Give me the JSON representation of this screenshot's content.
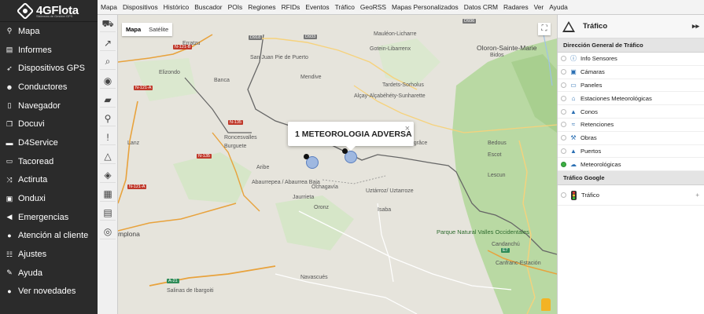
{
  "brand": {
    "name": "4GFlota",
    "tagline": "Sistemas de Gestión GPS"
  },
  "sidebar": {
    "items": [
      {
        "label": "Mapa",
        "icon": "map-pin-icon"
      },
      {
        "label": "Informes",
        "icon": "report-icon"
      },
      {
        "label": "Dispositivos GPS",
        "icon": "rocket-icon"
      },
      {
        "label": "Conductores",
        "icon": "user-icon"
      },
      {
        "label": "Navegador",
        "icon": "phone-icon"
      },
      {
        "label": "Docuvi",
        "icon": "documents-icon"
      },
      {
        "label": "D4Service",
        "icon": "folder-icon"
      },
      {
        "label": "Tacoread",
        "icon": "hdd-icon"
      },
      {
        "label": "Actiruta",
        "icon": "route-icon"
      },
      {
        "label": "Onduxi",
        "icon": "bus-icon"
      },
      {
        "label": "Emergencias",
        "icon": "bullhorn-icon"
      },
      {
        "label": "Atención al cliente",
        "icon": "info-icon"
      },
      {
        "label": "Ajustes",
        "icon": "settings-icon"
      },
      {
        "label": "Ayuda",
        "icon": "help-icon"
      },
      {
        "label": "Ver novedades",
        "icon": "dot-icon"
      }
    ]
  },
  "topmenu": [
    "Mapa",
    "Dispositivos",
    "Histórico",
    "Buscador",
    "POIs",
    "Regiones",
    "RFIDs",
    "Eventos",
    "Tráfico",
    "GeoRSS",
    "Mapas Personalizados",
    "Datos CRM",
    "Radares",
    "Ver",
    "Ayuda"
  ],
  "tools": [
    "truck-icon",
    "route-icon",
    "search-icon",
    "pin-icon",
    "hat-icon",
    "marker-icon",
    "alert-marker-icon",
    "traffic-icon",
    "layer-icon",
    "grid-icon",
    "case-icon",
    "target-icon"
  ],
  "map": {
    "type_buttons": [
      "Mapa",
      "Satélite"
    ],
    "popup_text": "1 METEOROLOGIA ADVERSA",
    "labels": {
      "mauleon": "Mauléon-Licharre",
      "gotein": "Gotein-Libarrenx",
      "oloron": "Oloron-Sainte-Marie",
      "bidos": "Bidos",
      "sjp": "San Juan Pie de Puerto",
      "erratzu": "Erratzu",
      "elizondo": "Elizondo",
      "banca": "Banca",
      "mendive": "Mendive",
      "tardets": "Tardets-Sorholus",
      "alcay": "Alçay-Alçabéhéty-Sunharette",
      "roncesvalles": "Roncesvalles",
      "burguete": "Burguete",
      "lanz": "Lanz",
      "sainte": "Sainte-Engrâce",
      "bedous": "Bedous",
      "escot": "Escot",
      "aribe": "Aribe",
      "lescun": "Lescun",
      "abaurrepea": "Abaurrepea / Abaurrea Baja",
      "ochagavia": "Ochagavía",
      "jaurrieta": "Jaurrieta",
      "uztarroz": "Uztárroz/ Uztarroze",
      "isaba": "Isaba",
      "oronz": "Oronz",
      "pamplona": "mplona",
      "parque": "Parque Natural Valles Occidentales",
      "navascues": "Navascués",
      "canfranc": "Canfranc-Estación",
      "candanchu": "Candanchú",
      "salinas": "Salinas de Ibargoiti"
    },
    "roads": {
      "d918": "D918",
      "d933": "D933",
      "d936": "D936",
      "n121b": "N-121-B",
      "n121a": "N-121-A",
      "n135a": "N-135",
      "n135b": "N-135",
      "n121a2": "N-121-A",
      "a21": "A-21",
      "e7": "E7"
    }
  },
  "panel": {
    "title": "Tráfico",
    "collapse": "▸▸",
    "section_dgt": "Dirección General de Tráfico",
    "layers": [
      {
        "label": "Info Sensores",
        "on": false
      },
      {
        "label": "Cámaras",
        "on": false
      },
      {
        "label": "Paneles",
        "on": false
      },
      {
        "label": "Estaciones Meteorológicas",
        "on": false
      },
      {
        "label": "Conos",
        "on": false
      },
      {
        "label": "Retenciones",
        "on": false
      },
      {
        "label": "Obras",
        "on": false
      },
      {
        "label": "Puertos",
        "on": false
      },
      {
        "label": "Meteorológicas",
        "on": true
      }
    ],
    "section_google": "Tráfico Google",
    "google_layer": "Tráfico"
  }
}
